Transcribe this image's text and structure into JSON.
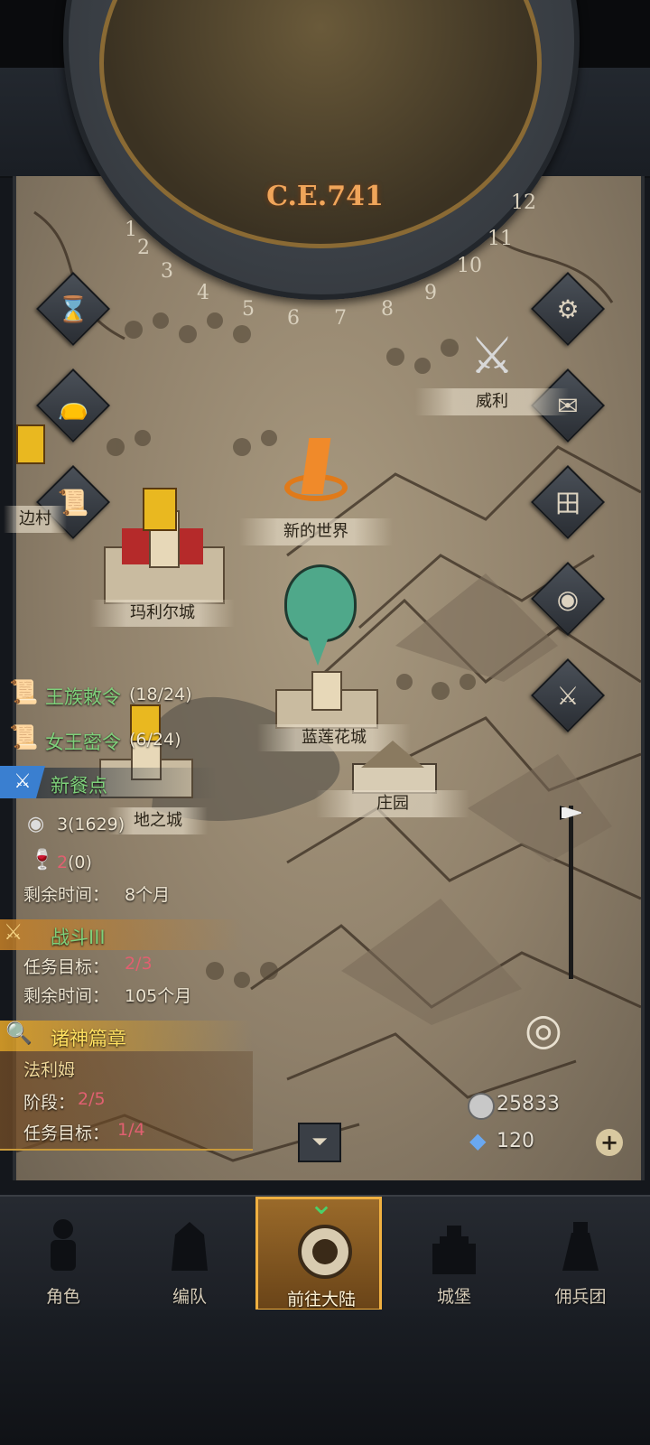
{
  "calendar": {
    "year": "C.E.741",
    "months": [
      "1",
      "2",
      "3",
      "4",
      "5",
      "6",
      "7",
      "8",
      "9",
      "10",
      "11",
      "12"
    ]
  },
  "locations": {
    "weili": "威利",
    "new_world": "新的世界",
    "marier_city": "玛利尔城",
    "lanlianhua_city": "蓝莲花城",
    "manor": "庄园",
    "border_village": "边村",
    "land_city": "地之城"
  },
  "quests": {
    "royal_decree": {
      "title": "王族敕令",
      "progress": "(18/24)"
    },
    "queen_order": {
      "title": "女王密令",
      "progress": "(6/24)"
    },
    "new_dining": {
      "title": "新餐点",
      "item1_count": "3",
      "item1_extra": "(1629)",
      "item2_count": "2",
      "item2_extra": "(0)",
      "time_label": "剩余时间：",
      "time_value": "8个月"
    },
    "battle": {
      "title": "战斗III",
      "goal_label": "任务目标：",
      "goal_value": "2/3",
      "time_label": "剩余时间：",
      "time_value": "105个月"
    },
    "gods_chapter": {
      "title": "诸神篇章",
      "name": "法利姆",
      "stage_label": "阶段：",
      "stage_value": "2/5",
      "goal_label": "任务目标：",
      "goal_value": "1/4"
    }
  },
  "resources": {
    "silver": "25833",
    "crystal": "120"
  },
  "nav": [
    {
      "label": "角色"
    },
    {
      "label": "编队"
    },
    {
      "label": "前往大陆"
    },
    {
      "label": "城堡"
    },
    {
      "label": "佣兵团"
    }
  ],
  "colors": {
    "accent_orange": "#f0a55a",
    "quest_green": "#7ed07a",
    "quest_red": "#e06070",
    "nav_active": "#f0b040"
  }
}
